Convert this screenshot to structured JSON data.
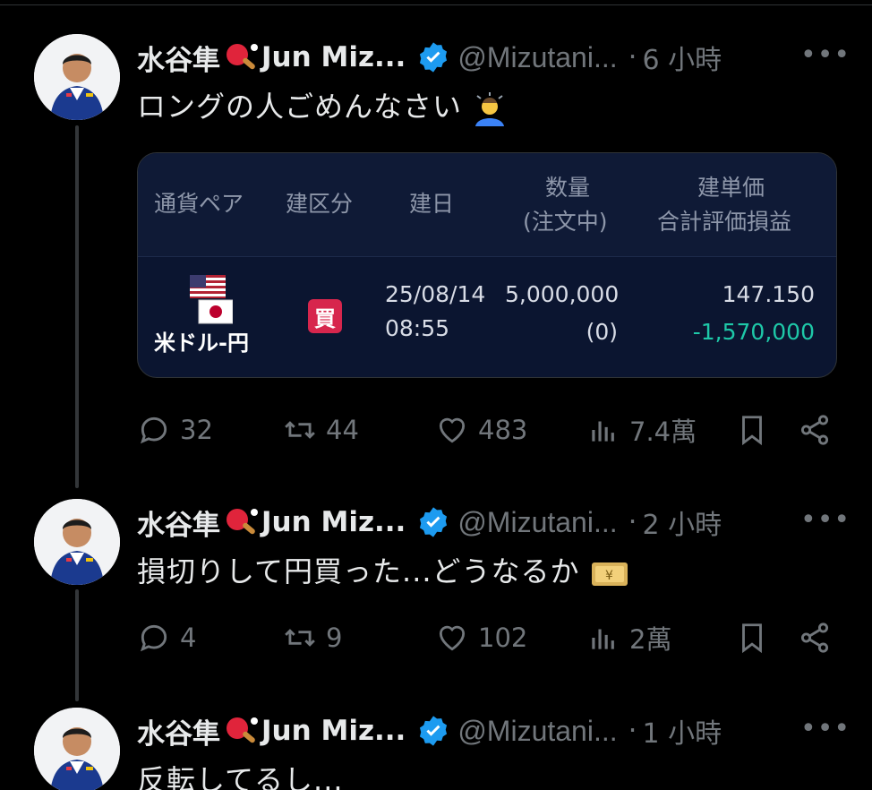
{
  "tweets": [
    {
      "name": "水谷隼",
      "name_suffix": "Jun Miz...",
      "handle": "@Mizutani...",
      "separator": "·",
      "time": "6 小時",
      "more": "•••",
      "text": "ロングの人ごめんなさい",
      "text_emoji": "person-bowing-emoji",
      "card": {
        "headers": [
          "通貨ペア",
          "建区分",
          "建日",
          "数量",
          "(注文中)",
          "建単価",
          "合計評価損益"
        ],
        "pair_label": "米ドル-円",
        "side_label": "買",
        "date": "25/08/14",
        "time": "08:55",
        "quantity": "5,000,000",
        "quantity_pending": "(0)",
        "price": "147.150",
        "pnl": "-1,570,000",
        "pnl_color": "#1ec8a8"
      },
      "stats": {
        "replies": "32",
        "retweets": "44",
        "likes": "483",
        "views": "7.4萬"
      }
    },
    {
      "name": "水谷隼",
      "name_suffix": "Jun Miz...",
      "handle": "@Mizutani...",
      "separator": "·",
      "time": "2 小時",
      "more": "•••",
      "text": "損切りして円買った...どうなるか",
      "text_emoji": "yen-banknote-emoji",
      "stats": {
        "replies": "4",
        "retweets": "9",
        "likes": "102",
        "views": "2萬"
      }
    },
    {
      "name": "水谷隼",
      "name_suffix": "Jun Miz...",
      "handle": "@Mizutani...",
      "separator": "·",
      "time": "1 小時",
      "more": "•••",
      "text": "反転してるし..."
    }
  ],
  "colors": {
    "background": "#000000",
    "muted": "#71767b",
    "verified": "#1d9bf0",
    "buy": "#d7264d"
  }
}
